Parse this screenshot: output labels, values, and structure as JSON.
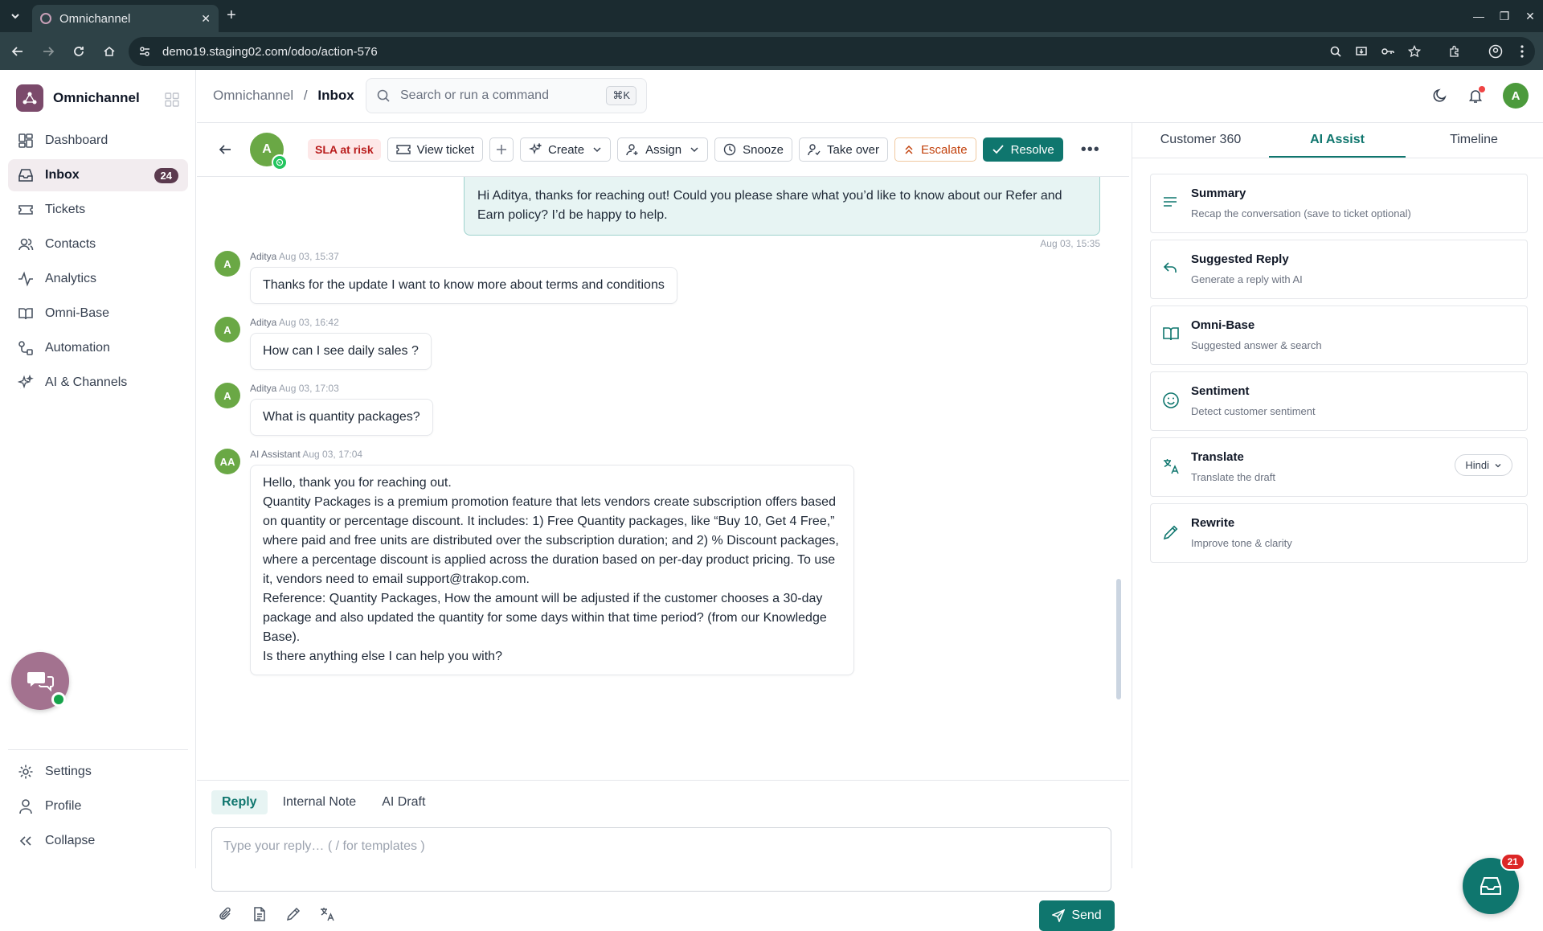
{
  "browser": {
    "tab_title": "Omnichannel",
    "url": "demo19.staging02.com/odoo/action-576"
  },
  "sidebar": {
    "brand": "Omnichannel",
    "items": [
      {
        "label": "Dashboard",
        "icon": "dashboard-icon"
      },
      {
        "label": "Inbox",
        "icon": "inbox-icon",
        "badge": "24",
        "active": true
      },
      {
        "label": "Tickets",
        "icon": "ticket-icon"
      },
      {
        "label": "Contacts",
        "icon": "contacts-icon"
      },
      {
        "label": "Analytics",
        "icon": "analytics-icon"
      },
      {
        "label": "Omni-Base",
        "icon": "book-icon"
      },
      {
        "label": "Automation",
        "icon": "automation-icon"
      },
      {
        "label": "AI & Channels",
        "icon": "sparkle-icon"
      }
    ],
    "bottom": [
      {
        "label": "Settings",
        "icon": "gear-icon"
      },
      {
        "label": "Profile",
        "icon": "user-icon"
      },
      {
        "label": "Collapse",
        "icon": "collapse-icon"
      }
    ]
  },
  "topbar": {
    "crumb_root": "Omnichannel",
    "crumb_sep": "/",
    "crumb_current": "Inbox",
    "search_placeholder": "Search or run a command",
    "shortcut": "⌘K",
    "user_initial": "A"
  },
  "ticket": {
    "customer_initial": "A",
    "sla": "SLA at risk",
    "view_ticket": "View ticket",
    "create": "Create",
    "assign": "Assign",
    "snooze": "Snooze",
    "take_over": "Take over",
    "escalate": "Escalate",
    "resolve": "Resolve"
  },
  "messages": {
    "outgoing": {
      "text": "Hi Aditya, thanks for reaching out! Could you please share what you’d like to know about our Refer and Earn policy? I’d be happy to help.",
      "time": "Aug 03, 15:35"
    },
    "items": [
      {
        "initial": "A",
        "author": "Aditya",
        "time": "Aug 03, 15:37",
        "text": "Thanks for the update I want to know more about terms and conditions"
      },
      {
        "initial": "A",
        "author": "Aditya",
        "time": "Aug 03, 16:42",
        "text": "How can I see daily sales ?"
      },
      {
        "initial": "A",
        "author": "Aditya",
        "time": "Aug 03, 17:03",
        "text": "What is quantity packages?"
      }
    ],
    "ai": {
      "initial": "AA",
      "author": "AI Assistant",
      "time": "Aug 03, 17:04",
      "lines": [
        "Hello, thank you for reaching out.",
        "Quantity Packages is a premium promotion feature that lets vendors create subscription offers based on quantity or percentage discount. It includes: 1) Free Quantity packages, like “Buy 10, Get 4 Free,” where paid and free units are distributed over the subscription duration; and 2) % Discount packages, where a percentage discount is applied across the duration based on per-day product pricing. To use it, vendors need to email support@trakop.com.",
        "Reference: Quantity Packages, How the amount will be adjusted if the customer chooses a 30-day package and also updated the quantity for some days within that time period? (from our Knowledge Base).",
        "Is there anything else I can help you with?"
      ]
    }
  },
  "composer": {
    "tabs": [
      "Reply",
      "Internal Note",
      "AI Draft"
    ],
    "placeholder": "Type your reply…  ( / for templates )",
    "send": "Send"
  },
  "right_panel": {
    "tabs": [
      "Customer 360",
      "AI Assist",
      "Timeline"
    ],
    "active_tab": "AI Assist",
    "cards": [
      {
        "title": "Summary",
        "sub": "Recap the conversation (save to ticket optional)",
        "icon": "lines-icon"
      },
      {
        "title": "Suggested Reply",
        "sub": "Generate a reply with AI",
        "icon": "reply-icon"
      },
      {
        "title": "Omni-Base",
        "sub": "Suggested answer & search",
        "icon": "book-icon"
      },
      {
        "title": "Sentiment",
        "sub": "Detect customer sentiment",
        "icon": "smile-icon"
      },
      {
        "title": "Translate",
        "sub": "Translate the draft",
        "icon": "translate-icon",
        "dropdown": "Hindi"
      },
      {
        "title": "Rewrite",
        "sub": "Improve tone & clarity",
        "icon": "pencil-icon"
      }
    ]
  },
  "fab_badge": "21",
  "colors": {
    "accent": "#0f766e",
    "brand": "#7b4a6b",
    "sla": "#b91c1c",
    "escalate": "#c2410c"
  }
}
